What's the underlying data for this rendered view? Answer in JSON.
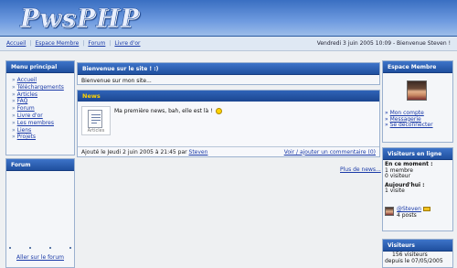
{
  "header": {
    "logo_text": "PwsPHP"
  },
  "nav": {
    "links": [
      "Accueil",
      "Espace Membre",
      "Forum",
      "Livre d'or"
    ],
    "date_text": "Vendredi 3 juin 2005 10:09 -  Bienvenue Steven !"
  },
  "left_menu": {
    "title": "Menu principal",
    "items": [
      "Accueil",
      "Téléchargements",
      "Articles",
      "FAQ",
      "Forum",
      "Livre d'or",
      "Les membres",
      "Liens",
      "Projets"
    ]
  },
  "forum_panel": {
    "title": "Forum",
    "link": "Aller sur le forum"
  },
  "welcome": {
    "title": "Bienvenue sur le site ! :)",
    "text": "Bienvenue sur mon site..."
  },
  "news": {
    "title": "News",
    "icon_caption": "Articles",
    "text": "Ma première news, bah, elle est là !",
    "footer_left_prefix": "Ajouté le Jeudi 2 juin 2005 à 21:45 par",
    "author": "Steven",
    "comments_link": "Voir / ajouter un commentaire (0)",
    "more_link": "Plus de news..."
  },
  "member_space": {
    "title": "Espace Membre",
    "links": [
      "Mon compte",
      "Messagerie",
      "Se déconnecter"
    ]
  },
  "online": {
    "title": "Visiteurs en ligne",
    "now_label": "En ce moment :",
    "now_members": "1 membre",
    "now_visitors": "0 visiteur",
    "today_label": "Aujourd'hui :",
    "today_visits": "1 visite",
    "user_name": "@Steven",
    "user_posts": "4 posts"
  },
  "visitors": {
    "title": "Visiteurs",
    "count_line": "156 visiteurs",
    "since_line": "depuis le 07/05/2005"
  },
  "colors": {
    "accent": "#1f4f9e",
    "link": "#1a3aa8",
    "news_title": "#ffd200"
  }
}
